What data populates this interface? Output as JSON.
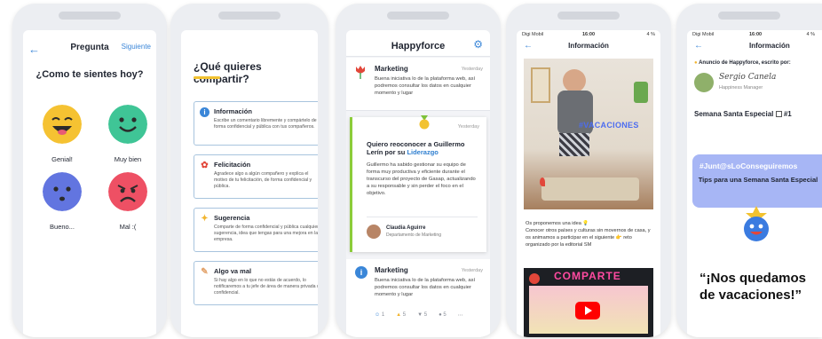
{
  "p1": {
    "back_icon": "←",
    "title": "Pregunta",
    "next": "Siguiente",
    "question": "¿Como te sientes hoy?",
    "faces": [
      {
        "label": "Genial!",
        "color": "#f5c232",
        "icon": "laughing-face-icon"
      },
      {
        "label": "Muy bien",
        "color": "#3fc596",
        "icon": "smiling-face-icon"
      },
      {
        "label": "Bueno...",
        "color": "#6275e0",
        "icon": "neutral-face-icon"
      },
      {
        "label": "Mal :(",
        "color": "#ee5064",
        "icon": "sad-face-icon"
      }
    ]
  },
  "p2": {
    "title": "¿Qué quieres compartir?",
    "cards": [
      {
        "title": "Información",
        "body": "Escribe un comentario libremente y compártelo de forma confidencial y pública con tus compañeros.",
        "icon": "info-icon",
        "color": "#3a86d8",
        "glyph": "i"
      },
      {
        "title": "Felicitación",
        "body": "Agradece algo a algún compañero y explica el motivo de tu felicitación, de forma confidencial y pública.",
        "icon": "tulip-icon",
        "color": "#e2473a",
        "glyph": "✿"
      },
      {
        "title": "Sugerencia",
        "body": "Comparte de forma confidencial y pública cualquier sugerencia, idea que tengas para una mejora en la empresa.",
        "icon": "lightbulb-icon",
        "color": "#f2b530",
        "glyph": "✦"
      },
      {
        "title": "Algo va mal",
        "body": "Si hay algo en lo que no estás de acuerdo, lo notificaremos a tu jefe de área de manera privada o confidencial.",
        "icon": "pencil-icon",
        "color": "#e3a26a",
        "glyph": "✎"
      }
    ]
  },
  "p3": {
    "brand": "Happyforce",
    "gear_icon": "⚙",
    "post1": {
      "name": "Marketing",
      "date": "Yesterday",
      "text": "Buena iniciativa lo de la plataforma web, así podremos consultar los datos en cualquier momento y lugar"
    },
    "post2": {
      "date": "Yesterday",
      "headline": "Quiero reoconocer a Guillermo Lerín por su",
      "highlight": "Liderazgo",
      "text": "Guillermo ha sabido gestionar su equipo de forma muy productiva y eficiente durante el transcurso del proyecto de Gasap, actualizando a su responsable y sin perder el foco en el objetivo.",
      "author": "Claudia Aguirre",
      "role": "Departamento de Marketing"
    },
    "post3": {
      "name": "Marketing",
      "date": "Yesterday",
      "text": "Buena iniciativa lo de la plataforma web, así podremos consultar los datos en cualquier momento y lugar"
    },
    "reactions": [
      "1",
      "5",
      "5",
      "5"
    ]
  },
  "p4": {
    "carrier": "Digi Mobil",
    "time": "16:00",
    "battery": "4 %",
    "title": "Información",
    "sign": "#VACACIONES",
    "caption": "Os proponemos una idea 💡\nConocer otros países y culturas sin movernos de casa, y os animamos a participar en el siguiente 👉 reto organizado por la editorial SM",
    "video_title": "COMPARTE"
  },
  "p5": {
    "carrier": "Digi Mobil",
    "time": "16:00",
    "battery": "4 %",
    "title": "Información",
    "announce": "Anuncio de Happyforce, escrito por:",
    "signature": "Sergio Canela",
    "role": "Happiness Manager",
    "subject": "Semana Santa Especial",
    "tag": "#1",
    "hashtag": "#Junt@sLoConseguiremos",
    "tips": "Tips para una Semana Santa Especial",
    "big": "“¡Nos quedamos de vacaciones!”"
  }
}
